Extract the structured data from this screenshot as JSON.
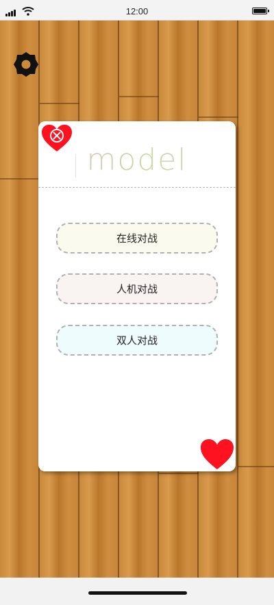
{
  "status_bar": {
    "time": "12:00",
    "signal_icon": "cellular-signal-icon",
    "wifi_icon": "wifi-icon",
    "battery_icon": "battery-icon",
    "battery_level": 1.0
  },
  "settings": {
    "icon": "gear-icon"
  },
  "dialog": {
    "title": "model",
    "close_icon": "heart-close-icon",
    "corner_icon": "heart-icon",
    "buttons": [
      {
        "label": "在线对战",
        "background": "#fbfaee"
      },
      {
        "label": "人机对战",
        "background": "#f9f3f2"
      },
      {
        "label": "双人对战",
        "background": "#effcfd"
      }
    ]
  },
  "colors": {
    "heart_red": "#ff1220",
    "wood": "#c98a3c",
    "dashed_border": "#b0b0b0"
  }
}
